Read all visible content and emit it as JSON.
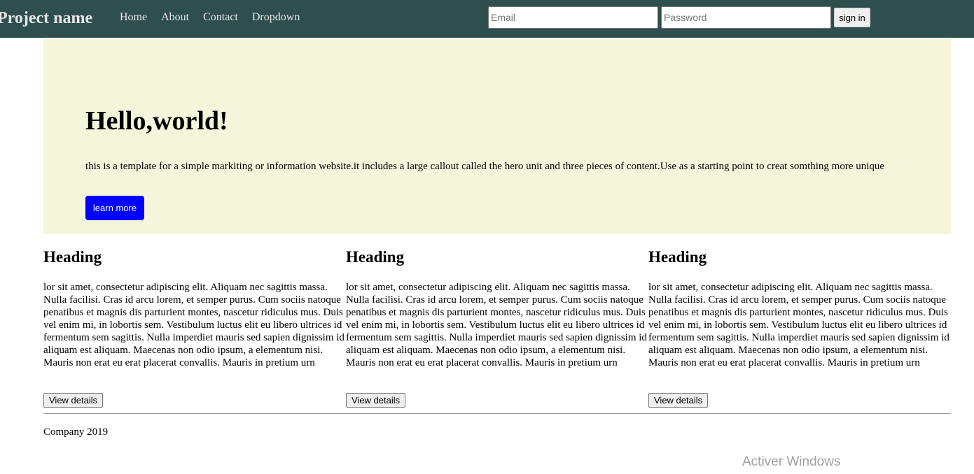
{
  "navbar": {
    "brand": "Project name",
    "links": [
      "Home",
      "About",
      "Contact",
      "Dropdown"
    ],
    "email_placeholder": "Email",
    "password_placeholder": "Password",
    "signin_label": "sign in",
    "background_color": "#2f4f4f"
  },
  "hero": {
    "title": "Hello,world!",
    "text": "this is a template for a simple markiting or information website.it includes a large callout called the hero unit and three pieces of content.Use as a starting point to creat somthing more unique",
    "button_label": "learn more",
    "background_color": "#f5f5dc",
    "button_color": "#0000ff"
  },
  "columns": [
    {
      "heading": "Heading",
      "text": "lor sit amet, consectetur adipiscing elit. Aliquam nec sagittis massa. Nulla facilisi. Cras id arcu lorem, et semper purus. Cum sociis natoque penatibus et magnis dis parturient montes, nascetur ridiculus mus. Duis vel enim mi, in lobortis sem. Vestibulum luctus elit eu libero ultrices id fermentum sem sagittis. Nulla imperdiet mauris sed sapien dignissim id aliquam est aliquam. Maecenas non odio ipsum, a elementum nisi. Mauris non erat eu erat placerat convallis. Mauris in pretium urn",
      "button_label": "View details"
    },
    {
      "heading": "Heading",
      "text": "lor sit amet, consectetur adipiscing elit. Aliquam nec sagittis massa. Nulla facilisi. Cras id arcu lorem, et semper purus. Cum sociis natoque penatibus et magnis dis parturient montes, nascetur ridiculus mus. Duis vel enim mi, in lobortis sem. Vestibulum luctus elit eu libero ultrices id fermentum sem sagittis. Nulla imperdiet mauris sed sapien dignissim id aliquam est aliquam. Maecenas non odio ipsum, a elementum nisi. Mauris non erat eu erat placerat convallis. Mauris in pretium urn",
      "button_label": "View details"
    },
    {
      "heading": "Heading",
      "text": "lor sit amet, consectetur adipiscing elit. Aliquam nec sagittis massa. Nulla facilisi. Cras id arcu lorem, et semper purus. Cum sociis natoque penatibus et magnis dis parturient montes, nascetur ridiculus mus. Duis vel enim mi, in lobortis sem. Vestibulum luctus elit eu libero ultrices id fermentum sem sagittis. Nulla imperdiet mauris sed sapien dignissim id aliquam est aliquam. Maecenas non odio ipsum, a elementum nisi. Mauris non erat eu erat placerat convallis. Mauris in pretium urn",
      "button_label": "View details"
    }
  ],
  "footer": {
    "text": "Company 2019"
  },
  "watermark": {
    "text": "Activer Windows"
  }
}
